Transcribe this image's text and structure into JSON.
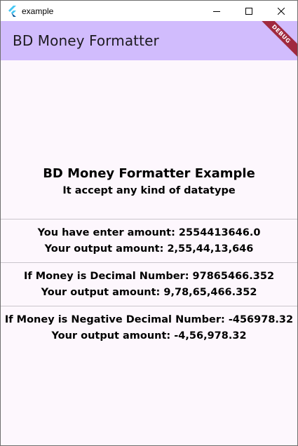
{
  "window": {
    "title": "example",
    "icons": {
      "app": "flutter-icon",
      "minimize": "minimize-icon",
      "maximize": "maximize-icon",
      "close": "close-icon"
    }
  },
  "appbar": {
    "title": "BD Money Formatter",
    "background": "#d1bcfd",
    "debug_banner": "DEBUG",
    "debug_color": "#a02a3f"
  },
  "main": {
    "heading": "BD Money Formatter Example",
    "subheading": "It accept any kind of datatype",
    "examples": [
      {
        "input": "You have enter amount: 2554413646.0",
        "output": "Your output amount: 2,55,44,13,646"
      },
      {
        "input": "If Money is Decimal Number: 97865466.352",
        "output": "Your output amount: 9,78,65,466.352"
      },
      {
        "input": "If Money is Negative Decimal Number: -456978.32",
        "output": "Your output amount: -4,56,978.32"
      }
    ]
  }
}
